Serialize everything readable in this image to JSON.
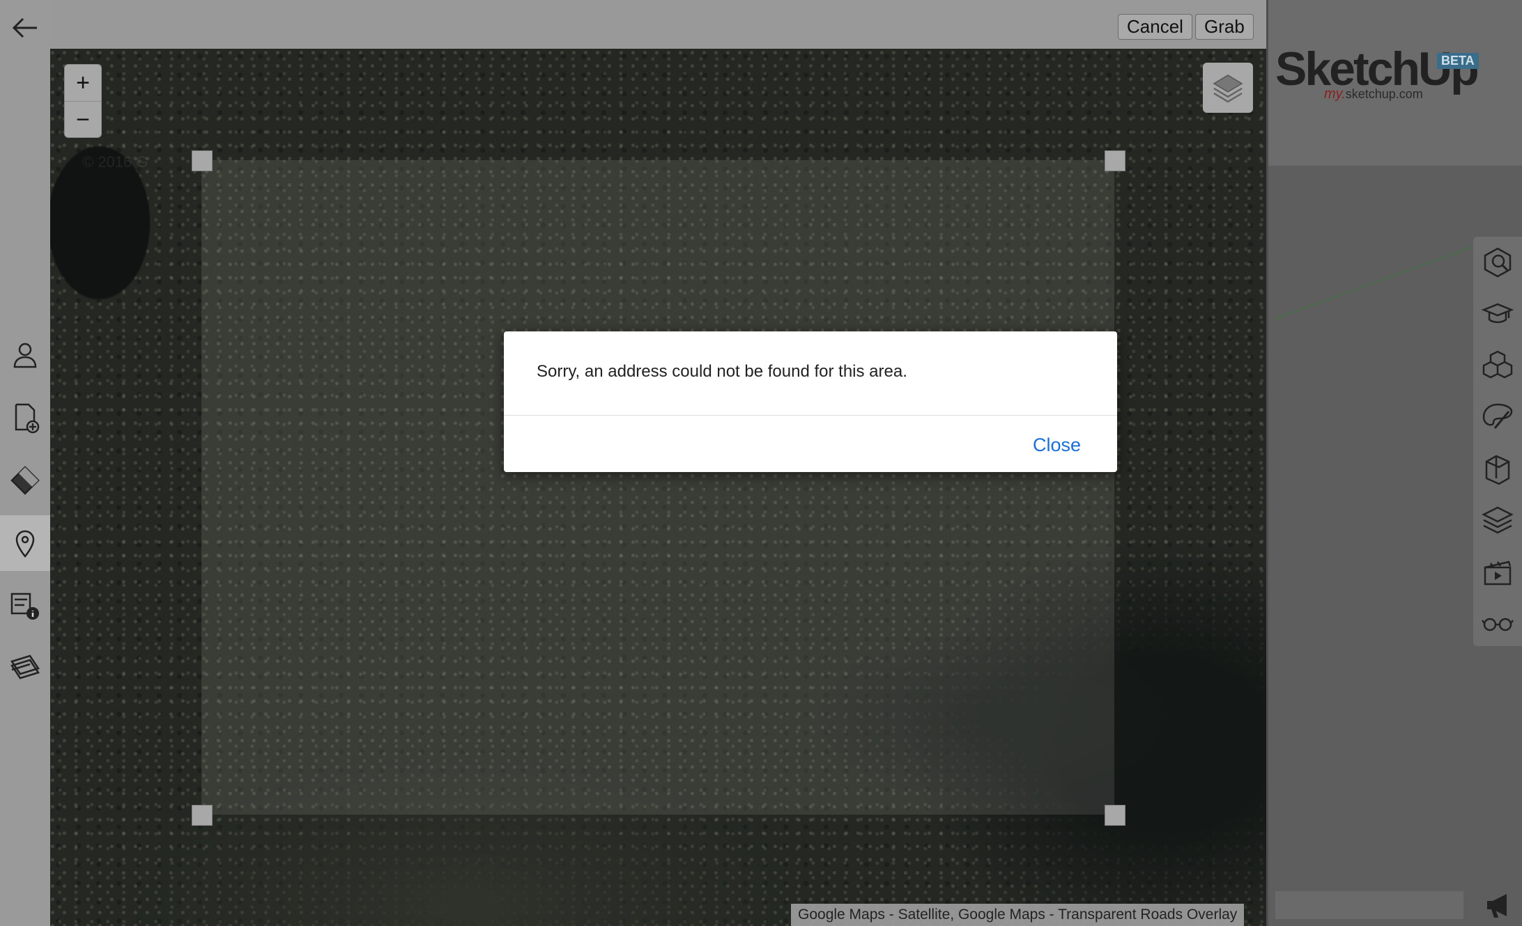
{
  "toolbar": {
    "cancel_label": "Cancel",
    "grab_label": "Grab"
  },
  "map": {
    "zoom_in": "+",
    "zoom_out": "−",
    "watermark": "© 2016 G",
    "attribution": "Google Maps - Satellite, Google Maps - Transparent Roads Overlay"
  },
  "dialog": {
    "message": "Sorry, an address could not be found for this area.",
    "close_label": "Close"
  },
  "logo": {
    "name": "SketchUp",
    "beta": "BETA",
    "sub_my": "my.",
    "sub_domain": "sketchup.com"
  },
  "left_tools": [
    "back-arrow-icon",
    "user-icon",
    "new-file-icon",
    "tag-icon",
    "location-pin-icon",
    "model-info-icon",
    "scenes-icon"
  ],
  "right_tools": [
    "search-components-icon",
    "learn-icon",
    "components-icon",
    "materials-icon",
    "solid-tools-icon",
    "layers-icon",
    "scenes-icon",
    "display-icon"
  ],
  "colors": {
    "link": "#1a6ed8",
    "beta_badge": "#3a6d8a"
  }
}
